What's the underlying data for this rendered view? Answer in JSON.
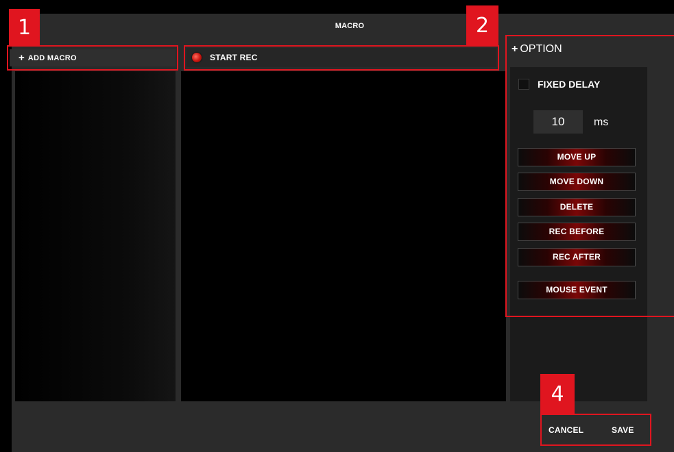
{
  "window": {
    "title": "MACRO"
  },
  "annotations": {
    "badge1": "1",
    "badge2": "2",
    "badge4": "4"
  },
  "macro_list": {
    "add_label": "ADD MACRO",
    "add_icon": "plus-icon"
  },
  "recorder": {
    "start_label": "START REC",
    "record_icon": "record-dot-icon"
  },
  "option": {
    "title": "OPTION",
    "title_icon": "plus-icon",
    "fixed_delay_label": "FIXED DELAY",
    "fixed_delay_checked": false,
    "delay_value": "10",
    "delay_unit": "ms",
    "buttons": [
      "MOVE UP",
      "MOVE DOWN",
      "DELETE",
      "REC BEFORE",
      "REC AFTER",
      "MOUSE EVENT"
    ]
  },
  "footer": {
    "cancel_label": "CANCEL",
    "save_label": "SAVE"
  },
  "colors": {
    "accent_red": "#e0151f",
    "window_bg": "#2b2b2b",
    "panel_bg": "#000000"
  }
}
